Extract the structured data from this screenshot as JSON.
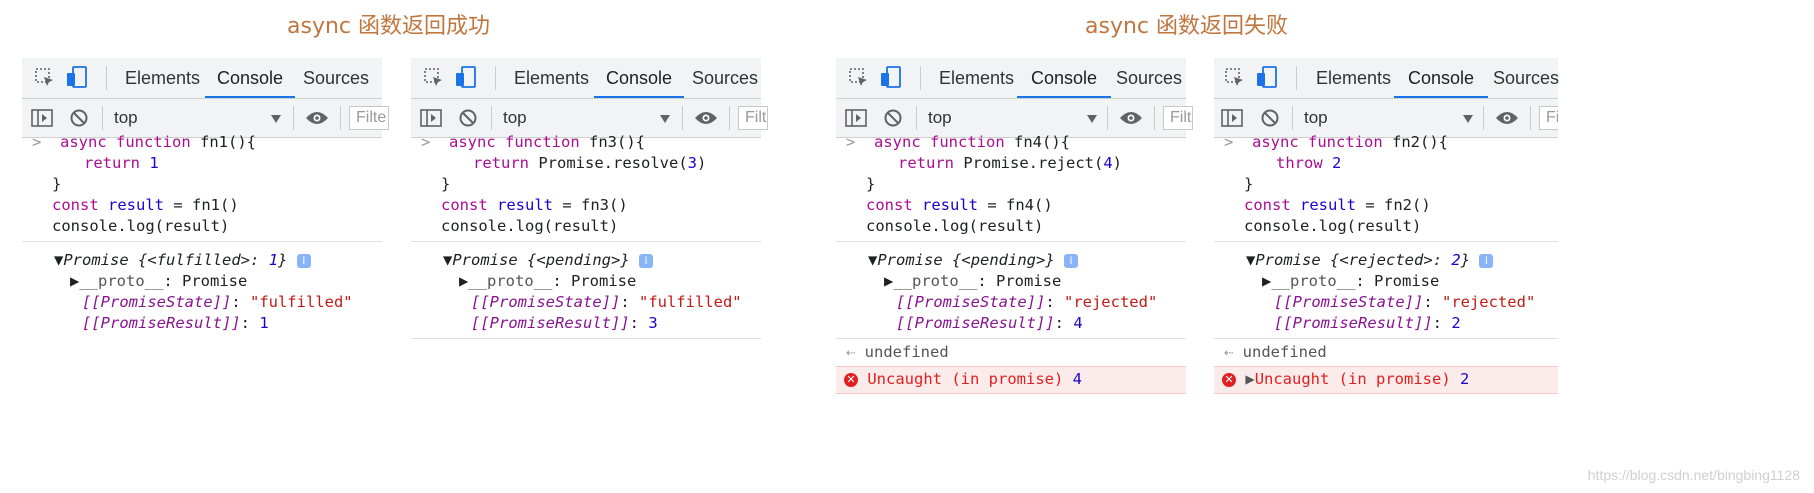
{
  "headings": {
    "success": "async 函数返回成功",
    "failure": "async 函数返回失败"
  },
  "devtools": {
    "tabs": [
      "Elements",
      "Console",
      "Sources"
    ],
    "context": "top",
    "filter_placeholders": [
      "Filte",
      "Filt",
      "Filt",
      "Fi"
    ]
  },
  "panels": [
    {
      "fn": "fn1",
      "body_call": "",
      "return_kw": "return",
      "return_value": "1",
      "promise_summary_key": "<fulfilled>",
      "promise_summary_value": "1",
      "state": "\"fulfilled\"",
      "result": "1"
    },
    {
      "fn": "fn3",
      "body_call": "Promise.resolve(",
      "return_kw": "return",
      "return_value": "3",
      "promise_summary_key": "<pending>",
      "promise_summary_value": "",
      "state": "\"fulfilled\"",
      "result": "3"
    },
    {
      "fn": "fn4",
      "body_call": "Promise.reject(",
      "return_kw": "return",
      "return_value": "4",
      "promise_summary_key": "<pending>",
      "promise_summary_value": "",
      "state": "\"rejected\"",
      "result": "4",
      "undefined_text": "undefined",
      "error_text": "Uncaught (in promise)",
      "error_value": "4"
    },
    {
      "fn": "fn2",
      "body_call": "",
      "return_kw": "throw",
      "return_value": "2",
      "promise_summary_key": "<rejected>",
      "promise_summary_value": "2",
      "state": "\"rejected\"",
      "result": "2",
      "undefined_text": "undefined",
      "error_text": "Uncaught (in promise)",
      "error_value": "2"
    }
  ],
  "code_tokens": {
    "async": "async",
    "function": "function",
    "const": "const",
    "result": "result",
    "console_log": "console.log(result)",
    "promise": "Promise",
    "proto": "__proto__",
    "proto_value": "Promise",
    "state_key": "[[PromiseState]]",
    "result_key": "[[PromiseResult]]"
  },
  "watermark": "https://blog.csdn.net/bingbing1128",
  "colors": {
    "heading": "#c0773f",
    "keyword": "#aa0d91",
    "number": "#1c00cf",
    "string": "#c41a16",
    "error": "#e02020",
    "tab_active": "#1a73e8"
  }
}
